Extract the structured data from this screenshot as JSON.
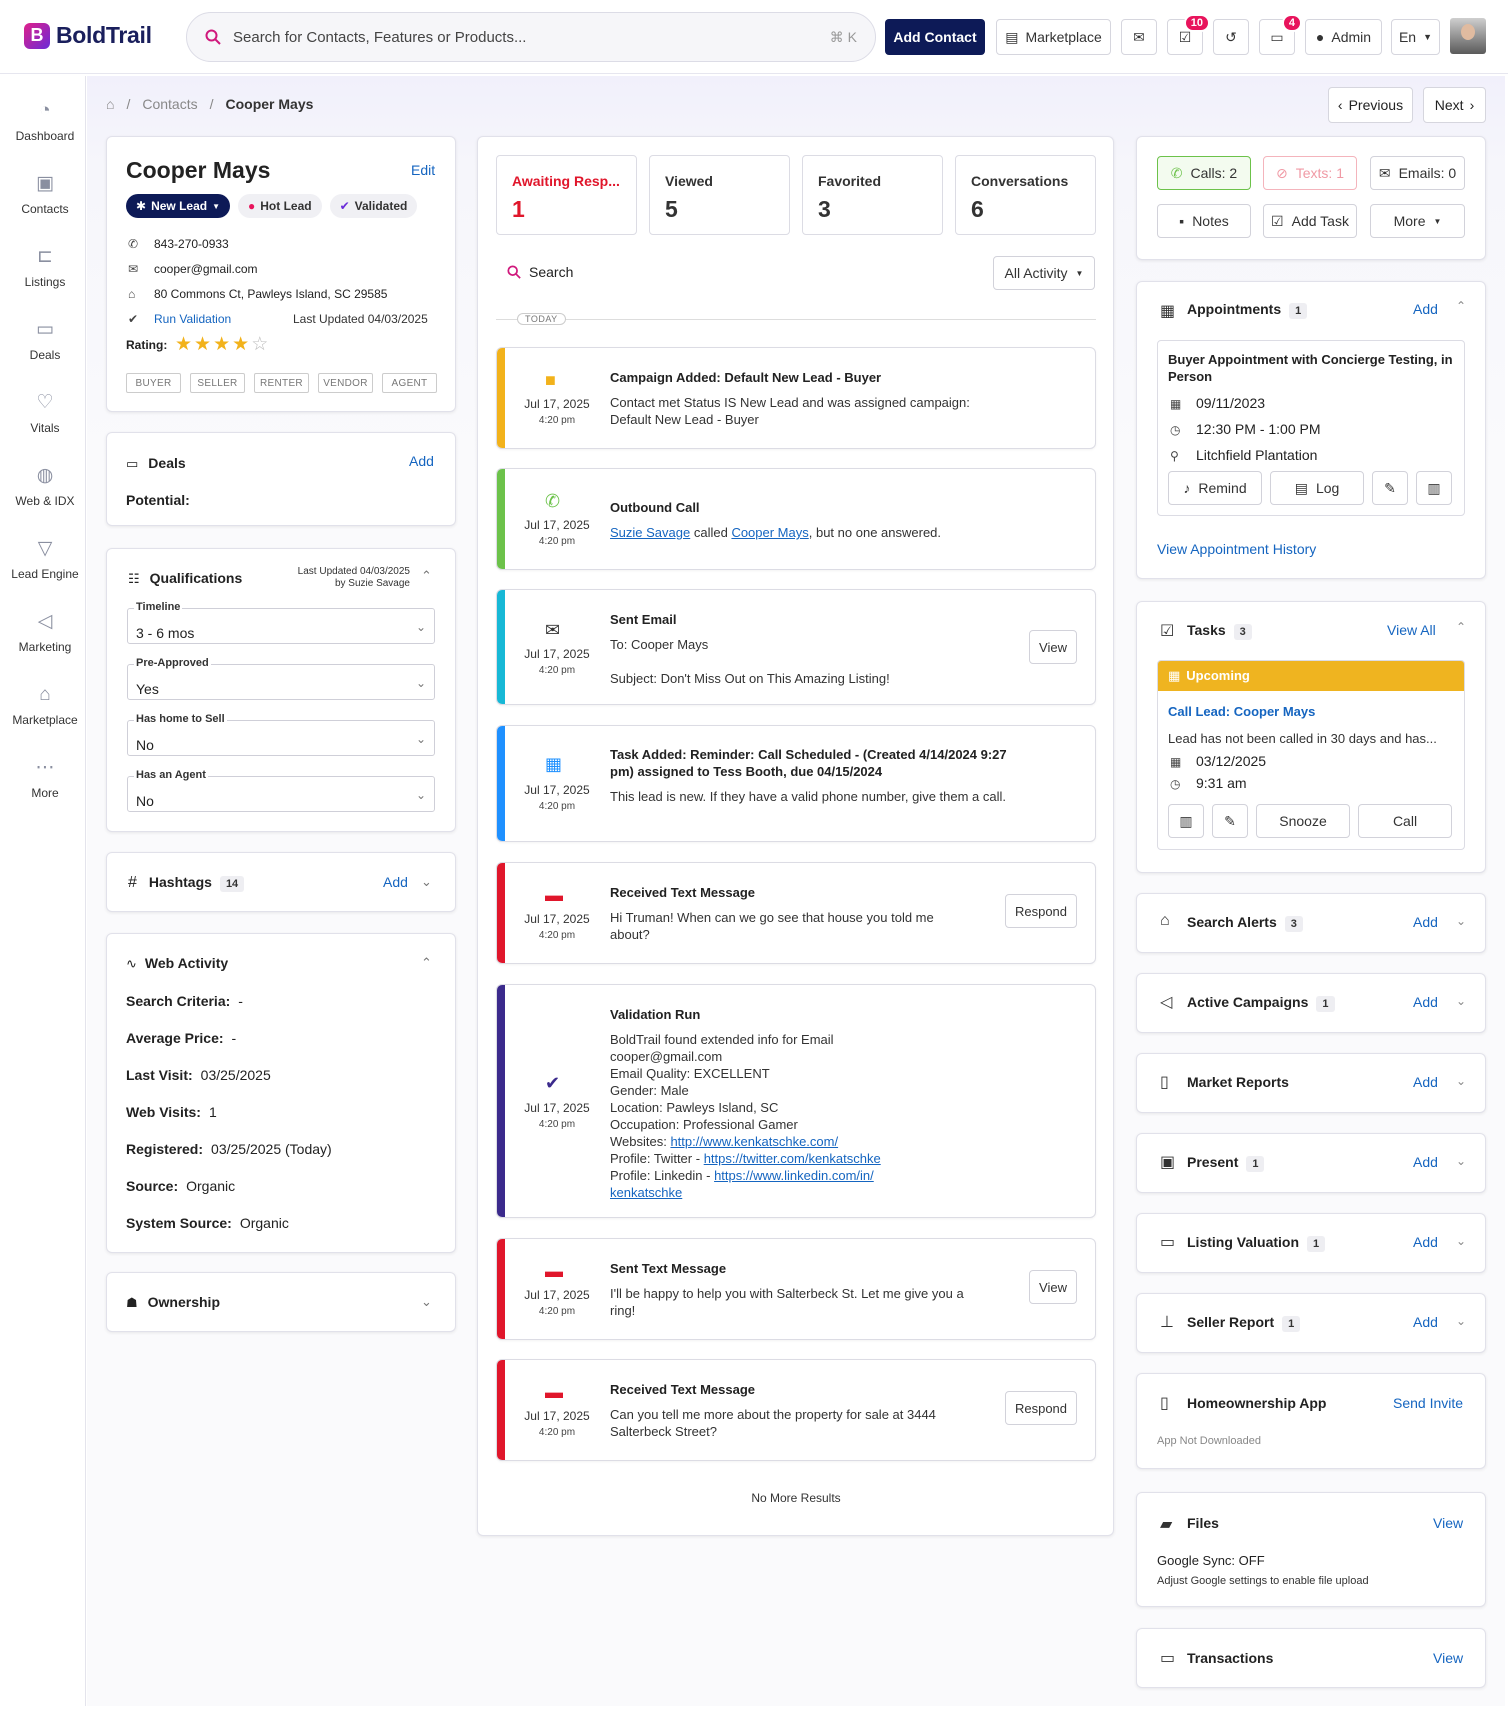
{
  "header": {
    "brand": "BoldTrail",
    "search_placeholder": "Search for Contacts, Features or Products...",
    "search_shortcut": "⌘ K",
    "add_contact": "Add Contact",
    "marketplace": "Marketplace",
    "tasks_badge": "10",
    "messages_badge": "4",
    "admin": "Admin",
    "language": "En"
  },
  "nav": [
    {
      "label": "Dashboard",
      "icon": "dashboard-icon"
    },
    {
      "label": "Contacts",
      "icon": "contacts-icon"
    },
    {
      "label": "Listings",
      "icon": "listings-icon"
    },
    {
      "label": "Deals",
      "icon": "deals-icon"
    },
    {
      "label": "Vitals",
      "icon": "vitals-icon"
    },
    {
      "label": "Web & IDX",
      "icon": "globe-icon"
    },
    {
      "label": "Lead Engine",
      "icon": "funnel-icon"
    },
    {
      "label": "Marketing",
      "icon": "megaphone-icon"
    },
    {
      "label": "Marketplace",
      "icon": "store-icon"
    },
    {
      "label": "More",
      "icon": "more-icon"
    }
  ],
  "breadcrumb": {
    "contacts": "Contacts",
    "current": "Cooper Mays"
  },
  "pager": {
    "previous": "Previous",
    "next": "Next"
  },
  "contact": {
    "name": "Cooper Mays",
    "edit": "Edit",
    "status": "New Lead",
    "tags": [
      "Hot Lead",
      "Validated"
    ],
    "phone": "843-270-0933",
    "email": "cooper@gmail.com",
    "address": "80 Commons Ct, Pawleys Island, SC 29585",
    "run_validation": "Run Validation",
    "last_updated": "Last Updated 04/03/2025",
    "rating_label": "Rating:",
    "rating": 4,
    "rating_max": 5,
    "roles": [
      "BUYER",
      "SELLER",
      "RENTER",
      "VENDOR",
      "AGENT"
    ]
  },
  "deals": {
    "title": "Deals",
    "add": "Add",
    "potential": "Potential:"
  },
  "qualifications": {
    "title": "Qualifications",
    "updated": "Last Updated 04/03/2025",
    "updated_by": "by Suzie Savage",
    "fields": [
      {
        "label": "Timeline",
        "value": "3 - 6 mos"
      },
      {
        "label": "Pre-Approved",
        "value": "Yes"
      },
      {
        "label": "Has home to Sell",
        "value": "No"
      },
      {
        "label": "Has an Agent",
        "value": "No"
      }
    ]
  },
  "hashtags": {
    "title": "Hashtags",
    "count": "14",
    "add": "Add"
  },
  "web_activity": {
    "title": "Web Activity",
    "rows": [
      {
        "label": "Search Criteria:",
        "value": "-"
      },
      {
        "label": "Average Price:",
        "value": "-"
      },
      {
        "label": "Last Visit:",
        "value": "03/25/2025"
      },
      {
        "label": "Web Visits:",
        "value": "1"
      },
      {
        "label": "Registered:",
        "value": "03/25/2025 (Today)"
      },
      {
        "label": "Source:",
        "value": "Organic"
      },
      {
        "label": "System Source:",
        "value": "Organic"
      }
    ]
  },
  "ownership": {
    "title": "Ownership"
  },
  "stats": [
    {
      "label": "Awaiting Resp...",
      "value": "1",
      "color": "#e0162b"
    },
    {
      "label": "Viewed",
      "value": "5",
      "color": "#333333"
    },
    {
      "label": "Favorited",
      "value": "3",
      "color": "#333333"
    },
    {
      "label": "Conversations",
      "value": "6",
      "color": "#333333"
    }
  ],
  "activity": {
    "search": "Search",
    "filter": "All Activity",
    "today": "TODAY",
    "no_more": "No More Results",
    "items": [
      {
        "title": "Campaign Added: Default New Lead - Buyer",
        "body": "Contact met Status IS New Lead and was assigned campaign: Default New Lead - Buyer",
        "date": "Jul 17, 2025",
        "time": "4:20 pm",
        "color": "#f2b21b",
        "icon": "campaign-icon"
      },
      {
        "title": "Outbound Call",
        "body_parts": [
          "Suzie Savage",
          " called ",
          "Cooper Mays",
          ", but no one answered."
        ],
        "date": "Jul 17, 2025",
        "time": "4:20 pm",
        "color": "#6cc24a",
        "icon": "phone-icon"
      },
      {
        "title": "Sent Email",
        "to": "To: Cooper Mays",
        "body": "Subject: Don't Miss Out on This Amazing Listing!",
        "button": "View",
        "date": "Jul 17, 2025",
        "time": "4:20 pm",
        "color": "#17b8d6",
        "icon": "email-icon"
      },
      {
        "title": "Task Added: Reminder: Call Scheduled - (Created 4/14/2024 9:27 pm) assigned to Tess Booth, due 04/15/2024",
        "body": "This lead is new. If they have a valid phone number, give them a call.",
        "date": "Jul 17, 2025",
        "time": "4:20 pm",
        "color": "#1e90ff",
        "icon": "calendar-icon"
      },
      {
        "title": "Received Text Message",
        "body": "Hi Truman! When can we go see that house you told me about?",
        "button": "Respond",
        "date": "Jul 17, 2025",
        "time": "4:20 pm",
        "color": "#e0162b",
        "icon": "text-message-icon"
      },
      {
        "title": "Validation Run",
        "lines": [
          "BoldTrail found extended info for Email",
          "cooper@gmail.com",
          "Email Quality: EXCELLENT",
          "Gender: Male",
          "Location: Pawleys Island, SC",
          "Occupation: Professional Gamer"
        ],
        "websites_label": "Websites: ",
        "website": "http://www.kenkatschke.com/",
        "twitter_label": "Profile: Twitter - ",
        "twitter": "https://twitter.com/kenkatschke",
        "linkedin_label": "Profile: Linkedin - ",
        "linkedin": "https://www.linkedin.com/in/",
        "linkedin2": "kenkatschke",
        "date": "Jul 17, 2025",
        "time": "4:20 pm",
        "color": "#3b2a8c",
        "icon": "verified-icon"
      },
      {
        "title": "Sent Text Message",
        "body": "I'll be happy to help you with Salterbeck St. Let me give you a ring!",
        "button": "View",
        "date": "Jul 17, 2025",
        "time": "4:20 pm",
        "color": "#e0162b",
        "icon": "text-message-icon"
      },
      {
        "title": "Received Text Message",
        "body": "Can you tell me more about the property for sale at 3444 Salterbeck Street?",
        "button": "Respond",
        "date": "Jul 17, 2025",
        "time": "4:20 pm",
        "color": "#e0162b",
        "icon": "text-message-icon"
      }
    ]
  },
  "comms": {
    "calls": "Calls: 2",
    "texts": "Texts: 1",
    "emails": "Emails: 0",
    "notes": "Notes",
    "add_task": "Add Task",
    "more": "More"
  },
  "appointments": {
    "title": "Appointments",
    "count": "1",
    "add": "Add",
    "item_title": "Buyer Appointment with Concierge Testing, in Person",
    "date": "09/11/2023",
    "time": "12:30 PM - 1:00 PM",
    "location": "Litchfield Plantation",
    "remind": "Remind",
    "log": "Log",
    "history": "View Appointment History"
  },
  "tasks": {
    "title": "Tasks",
    "count": "3",
    "view_all": "View All",
    "upcoming": "Upcoming",
    "task_title": "Call Lead: Cooper Mays",
    "task_body": "Lead has not been called in 30 days and has...",
    "date": "03/12/2025",
    "time": "9:31 am",
    "snooze": "Snooze",
    "call": "Call"
  },
  "sections": [
    {
      "title": "Search Alerts",
      "count": "3",
      "action": "Add",
      "icon": "home-search-icon"
    },
    {
      "title": "Active Campaigns",
      "count": "1",
      "action": "Add",
      "icon": "megaphone-icon"
    },
    {
      "title": "Market Reports",
      "count": "",
      "action": "Add",
      "icon": "report-icon"
    },
    {
      "title": "Present",
      "count": "1",
      "action": "Add",
      "icon": "presentation-icon"
    },
    {
      "title": "Listing Valuation",
      "count": "1",
      "action": "Add",
      "icon": "valuation-icon"
    },
    {
      "title": "Seller Report",
      "count": "1",
      "action": "Add",
      "icon": "chart-icon"
    }
  ],
  "homeownership": {
    "title": "Homeownership App",
    "action": "Send Invite",
    "status": "App Not Downloaded"
  },
  "files": {
    "title": "Files",
    "action": "View",
    "sync": "Google Sync: OFF",
    "note": "Adjust Google settings to enable file upload"
  },
  "transactions": {
    "title": "Transactions",
    "action": "View"
  }
}
